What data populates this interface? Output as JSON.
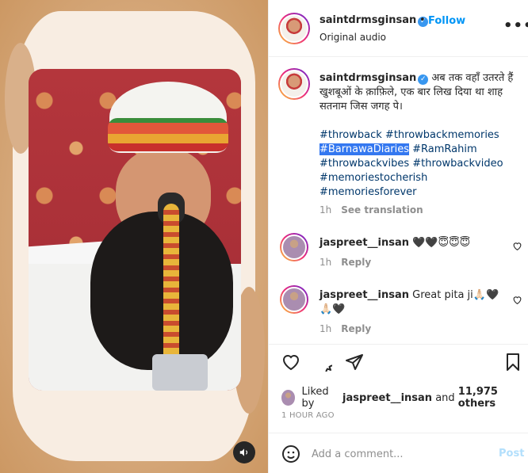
{
  "post": {
    "username": "saintdrmsginsan",
    "follow_label": "Follow",
    "dot": "•",
    "subtitle": "Original audio",
    "more": "•••"
  },
  "caption": {
    "username": "saintdrmsginsan",
    "text": "अब तक वहाँ उतरते हैं खुशबूओं के क़ाफ़िले, एक बार लिख दिया था शाह सतनाम जिस जगह पे।",
    "hashtags": [
      "#throwback",
      "#throwbackmemories",
      "#BarnawaDiaries",
      "#RamRahim",
      "#throwbackvibes",
      "#throwbackvideo",
      "#memoriestocherish",
      "#memoriesforever"
    ],
    "selected_hashtag_index": 2,
    "time": "1h",
    "see_translation": "See translation"
  },
  "comments": [
    {
      "username": "jaspreet__insan",
      "text": "🖤🖤😇😇😇",
      "time": "1h",
      "reply": "Reply"
    },
    {
      "username": "jaspreet__insan",
      "text": "Great pita ji🙏🏻🖤🙏🏻🖤",
      "time": "1h",
      "reply": "Reply"
    }
  ],
  "likes": {
    "prefix": "Liked by",
    "user": "jaspreet__insan",
    "and": "and",
    "others": "11,975 others"
  },
  "timestamp": "1 HOUR AGO",
  "add_comment": {
    "placeholder": "Add a comment...",
    "post_label": "Post"
  },
  "colors": {
    "accent": "#0095f6",
    "hashtag": "#00376b",
    "post_disabled": "#b2dffc"
  },
  "icons": [
    "heart-icon",
    "comment-icon",
    "share-icon",
    "bookmark-icon",
    "emoji-icon",
    "sound-icon",
    "more-icon",
    "verified-icon"
  ]
}
